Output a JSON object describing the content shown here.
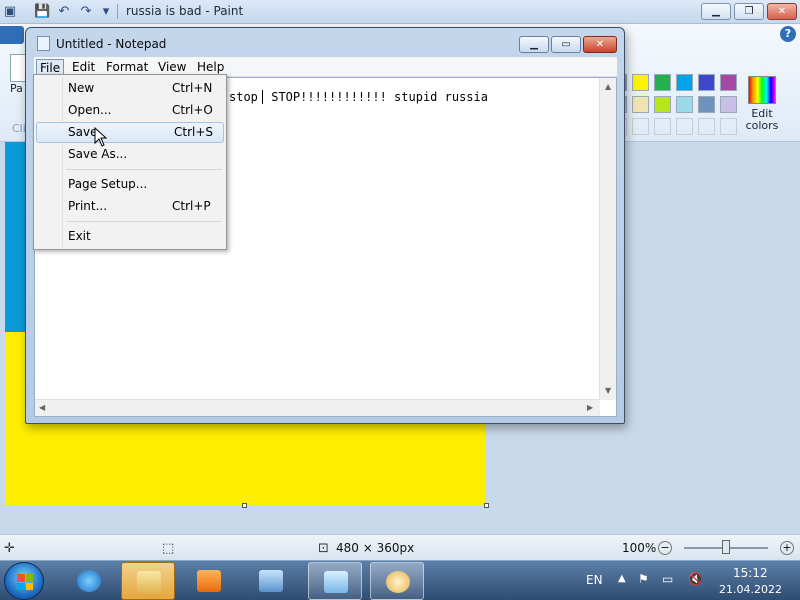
{
  "paint": {
    "title": "russia is bad - Paint",
    "ribbon_paste_label": "Pa",
    "ribbon_clipboard_label": "Cli",
    "edit_colors_label": "Edit colors",
    "help_label": "?",
    "image_size": "480 × 360px",
    "zoom": "100%",
    "zoom_minus": "−",
    "zoom_plus": "+",
    "palette_row1": [
      "#ff7f27",
      "#fff200",
      "#22b14c",
      "#00a2e8",
      "#3f48cc",
      "#a349a4"
    ],
    "palette_row2": [
      "#ffc90e",
      "#efe4b0",
      "#b5e61d",
      "#99d9ea",
      "#7092be",
      "#c8bfe7"
    ],
    "flag_colors": {
      "blue": "#0a9ad9",
      "yellow": "#ffee00"
    }
  },
  "notepad": {
    "title": "Untitled - Notepad",
    "menus": [
      "File",
      "Edit",
      "Format",
      "View",
      "Help"
    ],
    "text_before_caret": "stop",
    "text_after_caret": " STOP!!!!!!!!!!!! stupid russia",
    "file_menu": [
      {
        "label": "New",
        "shortcut": "Ctrl+N"
      },
      {
        "label": "Open...",
        "shortcut": "Ctrl+O"
      },
      {
        "label": "Save",
        "shortcut": "Ctrl+S"
      },
      {
        "label": "Save As...",
        "shortcut": ""
      },
      {
        "label": "Page Setup...",
        "shortcut": ""
      },
      {
        "label": "Print...",
        "shortcut": "Ctrl+P"
      },
      {
        "label": "Exit",
        "shortcut": ""
      }
    ],
    "highlighted_item": "Save"
  },
  "taskbar": {
    "language": "EN",
    "time": "15:12",
    "date": "21.04.2022"
  }
}
